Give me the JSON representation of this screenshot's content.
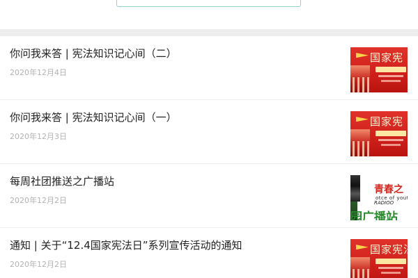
{
  "search": {
    "placeholder": ""
  },
  "articles": [
    {
      "title": "你问我来答 | 宪法知识记心间（二）",
      "date": "2020年12月4日",
      "thumbnail": {
        "kind": "constitution-day-poster",
        "text_big": "国家宪",
        "accent": "#d4281f"
      }
    },
    {
      "title": "你问我来答 | 宪法知识记心间（一）",
      "date": "2020年12月3日",
      "thumbnail": {
        "kind": "constitution-day-poster",
        "text_big": "国家宪",
        "accent": "#d4281f"
      }
    },
    {
      "title": "每周社团推送之广播站",
      "date": "2020年12月2日",
      "thumbnail": {
        "kind": "radio-station-poster",
        "text_title": "青春之",
        "text_sub": "otce of youth",
        "text_sub2": "RADIOO",
        "text_station": "园广播站",
        "accent": "#2a8a2e"
      }
    },
    {
      "title": "通知 | 关于“12.4国家宪法日”系列宣传活动的通知",
      "date": "2020年12月2日",
      "thumbnail": {
        "kind": "constitution-day-poster",
        "text_big": "国家宪法日",
        "accent": "#d4281f"
      }
    }
  ],
  "colors": {
    "title_text": "#222222",
    "date_text": "#b2b2b2",
    "separator_bar": "#ededed",
    "search_border": "#8ed1cd"
  }
}
